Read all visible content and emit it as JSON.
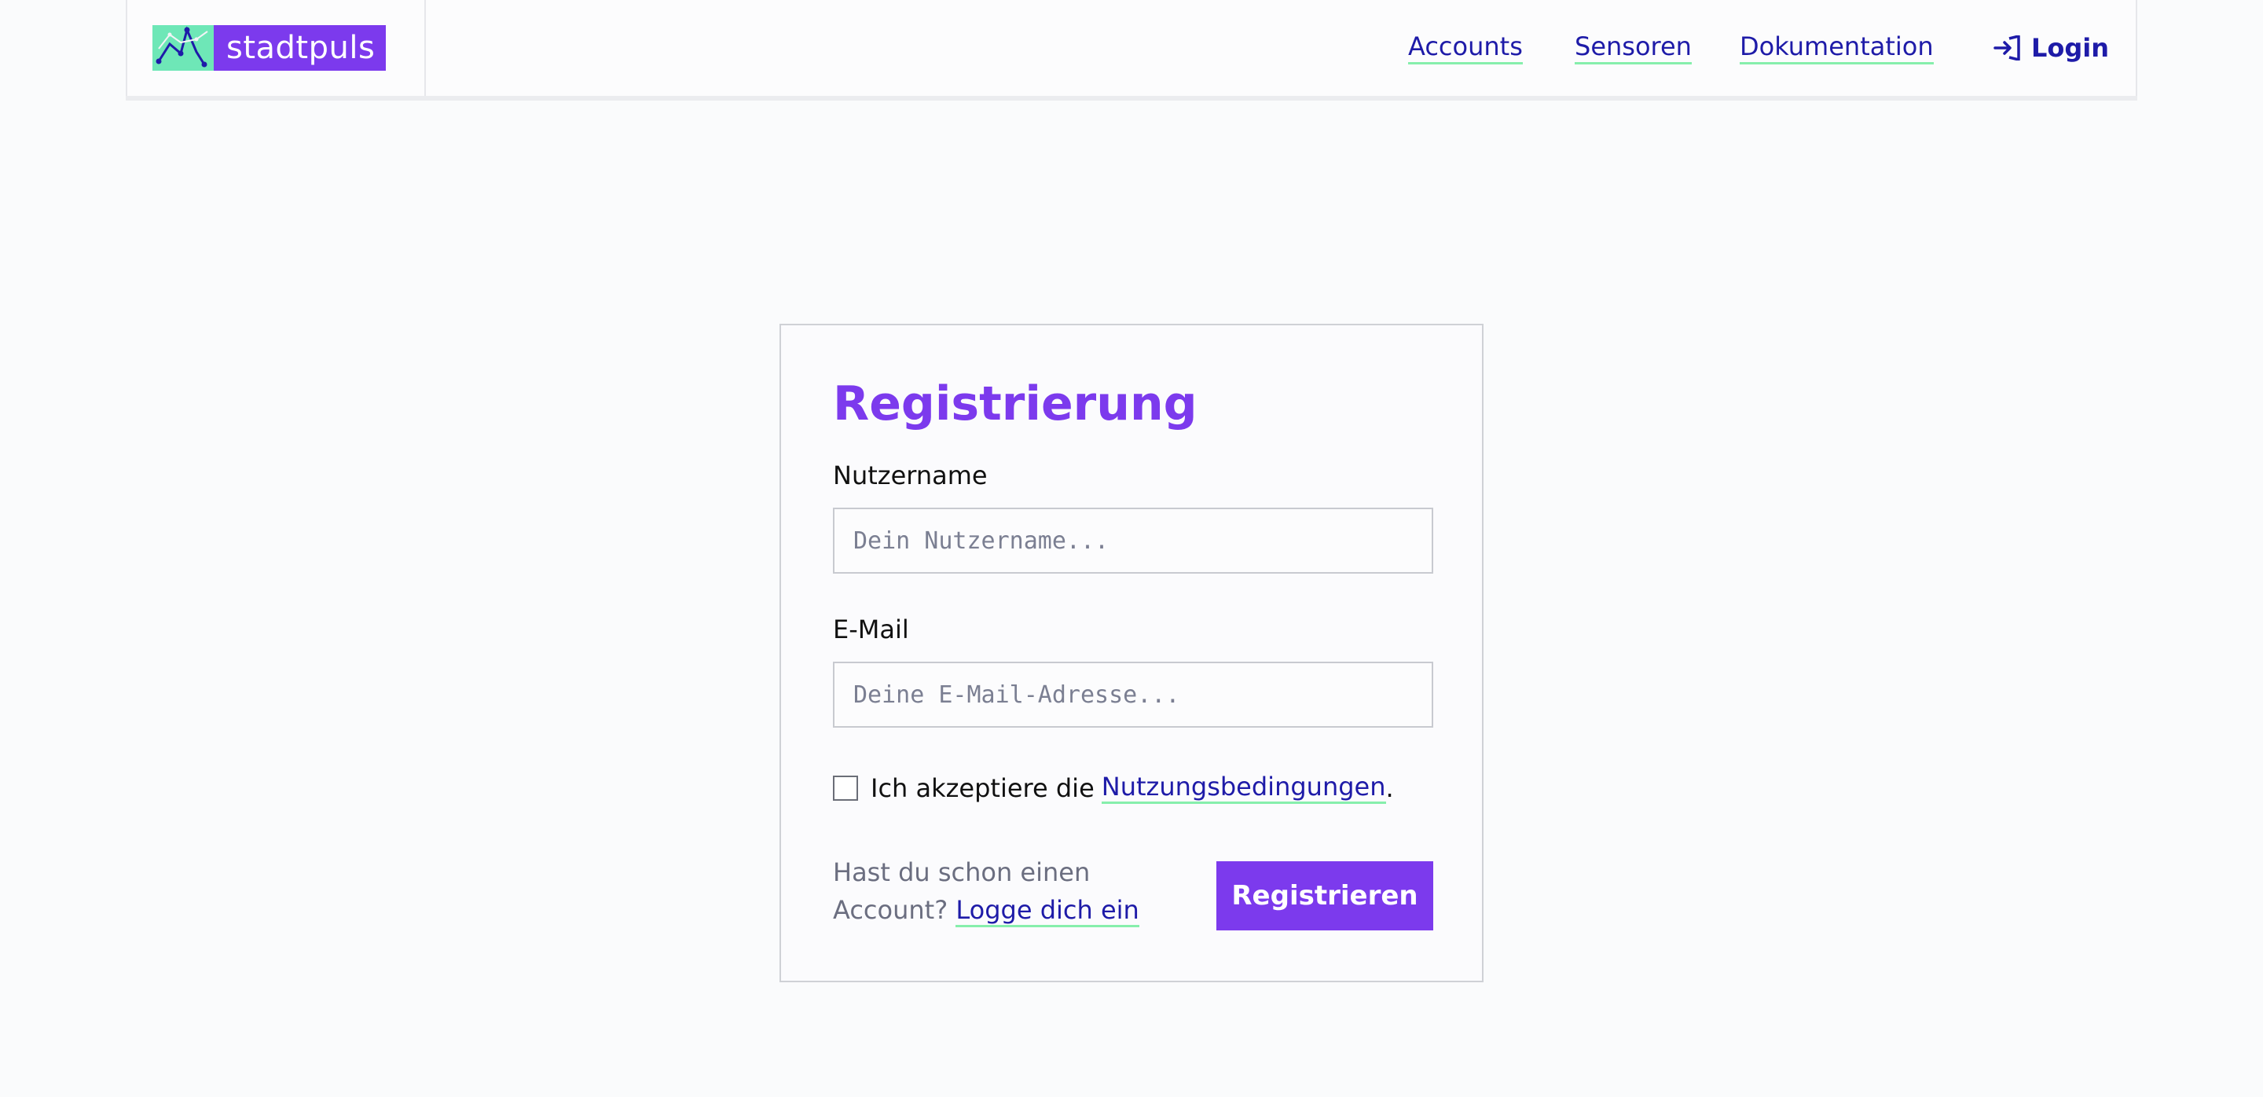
{
  "header": {
    "brand": "stadtpuls",
    "nav": [
      {
        "label": "Accounts"
      },
      {
        "label": "Sensoren"
      },
      {
        "label": "Dokumentation"
      }
    ],
    "login_label": "Login"
  },
  "form": {
    "title": "Registrierung",
    "username_label": "Nutzername",
    "username_placeholder": "Dein Nutzername...",
    "username_value": "",
    "email_label": "E-Mail",
    "email_placeholder": "Deine E-Mail-Adresse...",
    "email_value": "",
    "terms_prefix": "Ich akzeptiere die",
    "terms_link": "Nutzungsbedingungen",
    "terms_suffix": ".",
    "terms_checked": false,
    "login_hint": "Hast du schon einen Account?",
    "login_link": "Logge dich ein",
    "submit_label": "Registrieren"
  },
  "colors": {
    "accent": "#7c3aed",
    "link": "#1e1ba8",
    "underline": "#86efac",
    "logo_mark_bg": "#6ee7b7"
  },
  "icons": {
    "logo": "stadtpuls-logo-mark",
    "login": "login-arrow-icon"
  }
}
